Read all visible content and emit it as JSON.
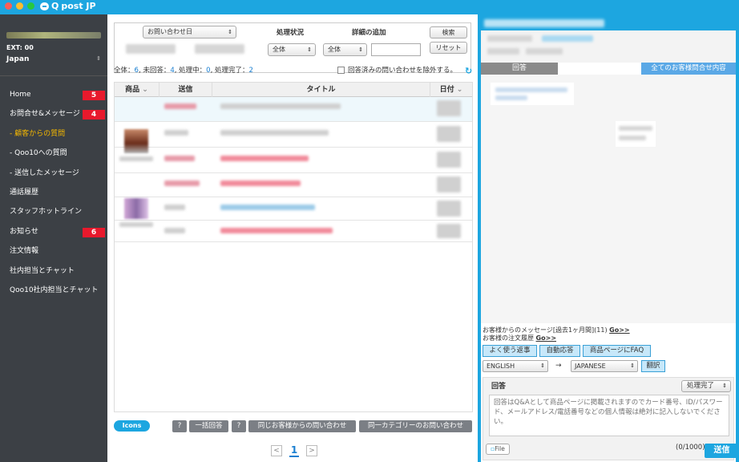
{
  "app": {
    "title": "post JP"
  },
  "sidebar": {
    "ext": "EXT: 00",
    "country": "Japan",
    "items": [
      {
        "label": "Home",
        "badge": "5"
      },
      {
        "label": "お問合せ&メッセージ",
        "badge": "4"
      },
      {
        "label": "- 顧客からの質問",
        "active": true
      },
      {
        "label": "- Qoo10への質問"
      },
      {
        "label": "- 送信したメッセージ"
      },
      {
        "label": "通話履歴"
      },
      {
        "label": "スタッフホットライン"
      },
      {
        "label": "お知らせ",
        "badge": "6"
      },
      {
        "label": "注文情報"
      },
      {
        "label": "社内担当とチャット"
      },
      {
        "label": "Qoo10社内担当とチャット"
      }
    ]
  },
  "filter": {
    "date_select": "お問い合わせ日",
    "status_label": "処理状況",
    "status_value": "全体",
    "detail_label": "詳細の追加",
    "detail_value": "全体",
    "search_button": "検索",
    "reset_button": "リセット"
  },
  "summary": {
    "prefix_total": "全体：",
    "total": "6",
    "prefix_unanswered": ", 未回答：",
    "unanswered": "4",
    "prefix_processing": ", 処理中：",
    "processing": "0",
    "prefix_done": ", 処理完了：",
    "done": "2",
    "exclude_label": "回答済みの問い合わせを除外する。"
  },
  "table": {
    "headers": {
      "product": "商品",
      "sent": "送信",
      "title": "タイトル",
      "date": "日付"
    }
  },
  "bottom": {
    "icons_logo": "Icons",
    "help1": "?",
    "bulk_reply": "一括回答",
    "help2": "?",
    "same_customer": "同じお客様からの問い合わせ",
    "same_category": "同一カテゴリーのお問い合わせ"
  },
  "pager": {
    "prev": "<",
    "current": "1",
    "next": ">"
  },
  "right": {
    "tab_reply": "回答",
    "tab_all": "全てのお客様問合せ内容",
    "customer_messages": "お客様からのメッセージ[過去1ヶ月間](11)",
    "customer_orders": "お客様の注文履歴",
    "go": "Go>>",
    "frequent_reply": "よく使う返事",
    "auto_reply": "自動応答",
    "product_faq": "商品ページにFAQ",
    "lang_from": "ENGLISH",
    "arrow": "→",
    "lang_to": "JAPANESE",
    "translate": "翻訳",
    "reply_label": "回答",
    "status": "処理完了",
    "reply_placeholder": "回答はQ&Aとして商品ページに掲載されますのでカード番号、ID/パスワード、メールアドレス/電話番号などの個人情報は絶対に記入しないでください。",
    "file": "File",
    "counter": "(0/1000)",
    "send": "送信"
  }
}
